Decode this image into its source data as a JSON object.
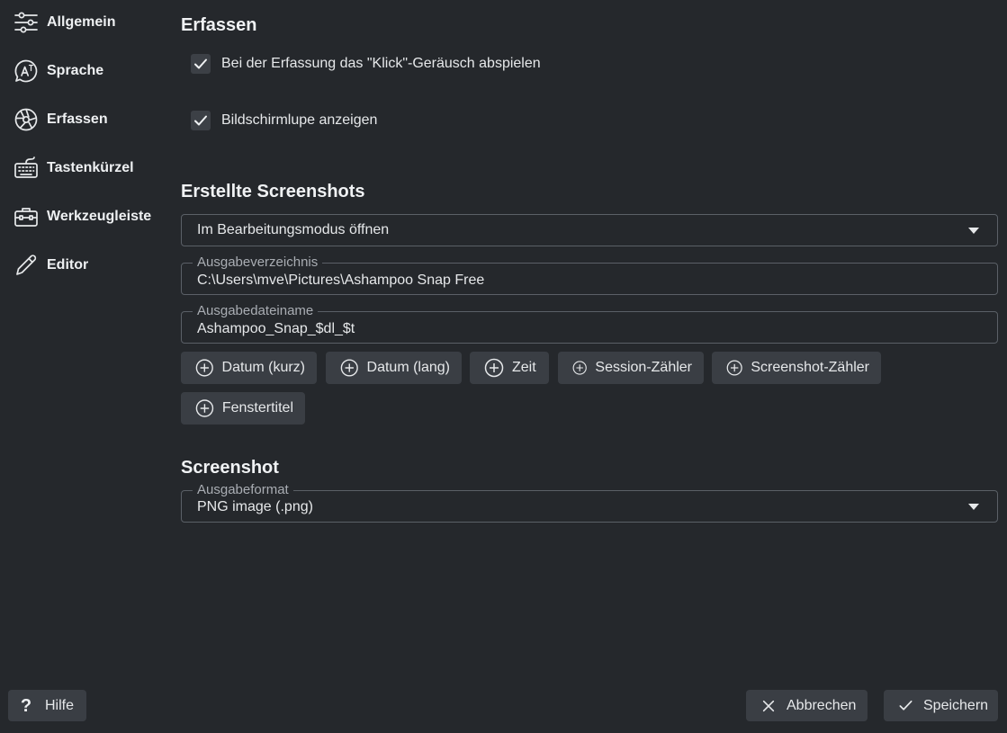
{
  "sidebar": {
    "items": [
      {
        "label": "Allgemein",
        "icon": "sliders-icon"
      },
      {
        "label": "Sprache",
        "icon": "language-icon"
      },
      {
        "label": "Erfassen",
        "icon": "aperture-icon"
      },
      {
        "label": "Tastenkürzel",
        "icon": "keyboard-icon"
      },
      {
        "label": "Werkzeugleiste",
        "icon": "toolbox-icon"
      },
      {
        "label": "Editor",
        "icon": "pencil-icon"
      }
    ]
  },
  "capture": {
    "title": "Erfassen",
    "click_sound_label": "Bei der Erfassung das \"Klick\"-Geräusch abspielen",
    "click_sound_checked": true,
    "magnifier_label": "Bildschirmlupe anzeigen",
    "magnifier_checked": true
  },
  "screenshots": {
    "title": "Erstellte Screenshots",
    "after_capture_value": "Im Bearbeitungsmodus öffnen",
    "output_dir_label": "Ausgabeverzeichnis",
    "output_dir_value": "C:\\Users\\mve\\Pictures\\Ashampoo Snap Free",
    "output_name_label": "Ausgabedateiname",
    "output_name_value": "Ashampoo_Snap_$dl_$t",
    "placeholders": [
      "Datum (kurz)",
      "Datum (lang)",
      "Zeit",
      "Session-Zähler",
      "Screenshot-Zähler",
      "Fenstertitel"
    ]
  },
  "screenshot": {
    "title": "Screenshot",
    "format_label": "Ausgabeformat",
    "format_value": "PNG image (.png)"
  },
  "footer": {
    "help_label": "Hilfe",
    "cancel_label": "Abbrechen",
    "save_label": "Speichern"
  }
}
